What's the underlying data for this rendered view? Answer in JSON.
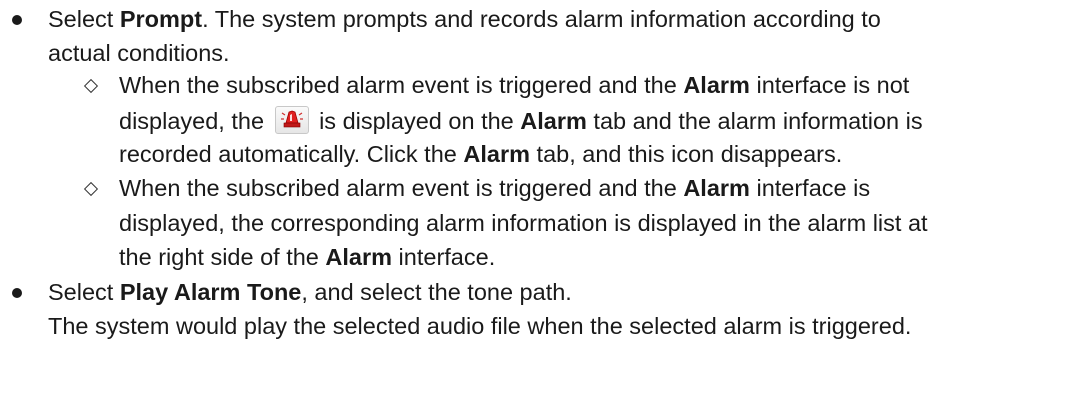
{
  "bullet1": {
    "text1": "Select ",
    "bold1": "Prompt",
    "text2": ". The system prompts and records alarm information according to",
    "line2": "actual conditions."
  },
  "sub1": {
    "t1": "When the subscribed alarm event is triggered and the ",
    "b1": "Alarm",
    "t2": " interface is not",
    "t3": "displayed, the ",
    "icon": "alarm-siren-icon",
    "t4": " is displayed on the ",
    "b2": "Alarm",
    "t5": " tab and the alarm information is",
    "t6": "recorded automatically. Click the ",
    "b3": "Alarm",
    "t7": " tab, and this icon disappears."
  },
  "sub2": {
    "t1": "When the subscribed alarm event is triggered and the ",
    "b1": "Alarm",
    "t2": " interface is",
    "t3": "displayed, the corresponding alarm information is displayed in the alarm list at",
    "t4": "the right side of the ",
    "b2": "Alarm",
    "t5": " interface."
  },
  "bullet2": {
    "text1": "Select ",
    "bold1": "Play Alarm Tone",
    "text2": ", and select the tone path.",
    "line2": "The system would play the selected audio file when the selected alarm is triggered."
  }
}
